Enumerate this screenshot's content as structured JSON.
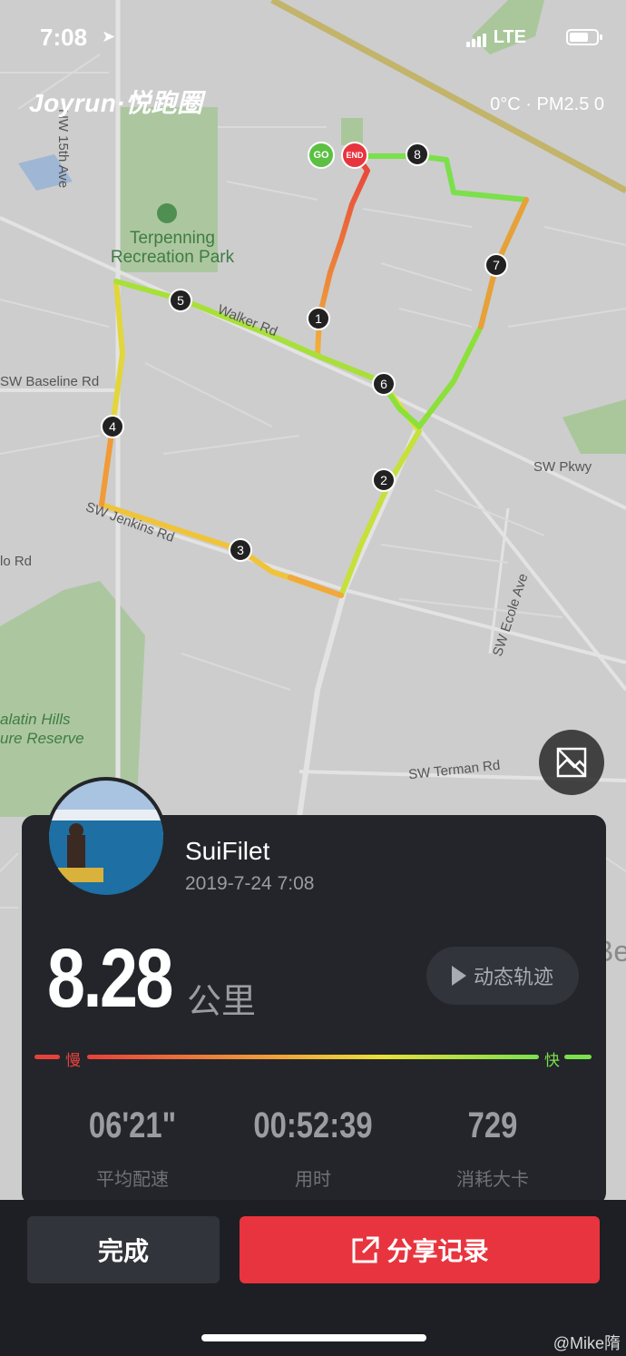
{
  "status_bar": {
    "time": "7:08",
    "network": "LTE"
  },
  "header": {
    "logo": "Joyrun·悦跑圈",
    "weather": "0°C · PM2.5 0"
  },
  "map": {
    "labels": {
      "nw15": "NW 15th Ave",
      "park": "Terpenning Recreation Park",
      "walker": "Walker Rd",
      "baseline": "SW Baseline Rd",
      "pkwy": "SW Pkwy",
      "ecole": "SW Ecole Ave",
      "terman": "SW Terman Rd",
      "hills": "alatin Hills ure Reserve",
      "lo": "lo Rd",
      "jenkins": "SW Jenkins Rd",
      "bea": "Bea"
    },
    "markers": [
      "1",
      "2",
      "3",
      "4",
      "5",
      "6",
      "7",
      "8"
    ],
    "go": "GO",
    "end": "END",
    "colors": {
      "slow": "#e8413a",
      "fast": "#7be04c"
    }
  },
  "profile": {
    "username": "SuiFilet",
    "date": "2019-7-24 7:08"
  },
  "summary": {
    "distance": "8.28",
    "unit": "公里",
    "dynamic_button": "动态轨迹",
    "legend_slow": "慢",
    "legend_fast": "快"
  },
  "stats": [
    {
      "value": "06'21\"",
      "label": "平均配速"
    },
    {
      "value": "00:52:39",
      "label": "用时"
    },
    {
      "value": "729",
      "label": "消耗大卡"
    }
  ],
  "actions": {
    "done": "完成",
    "share": "分享记录"
  },
  "watermark": "@Mike隋"
}
